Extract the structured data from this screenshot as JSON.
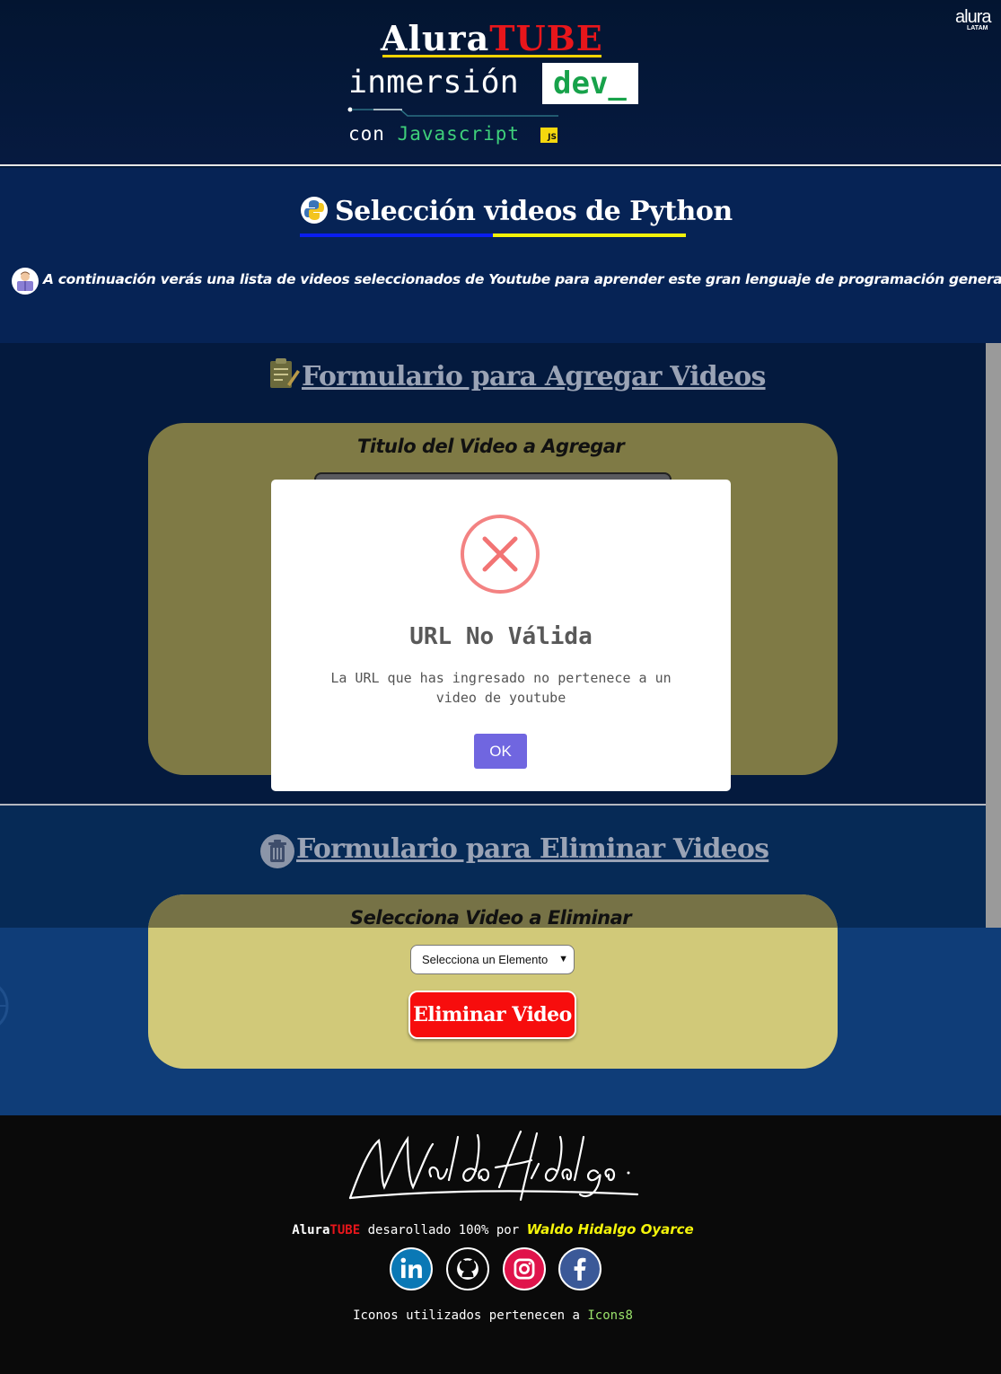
{
  "header": {
    "brand_alura": "Alura",
    "brand_tube": "TUBE",
    "inmersion": "inmersión",
    "dev": "dev_",
    "con": "con",
    "javascript": "Javascript",
    "js_badge": "JS",
    "corner_logo": "alura",
    "corner_logo_sub": "LATAM"
  },
  "intro": {
    "title": "Selección videos de Python",
    "text": "A continuación verás una lista de videos seleccionados de Youtube para aprender este gran lenguaje de programación general"
  },
  "add_form": {
    "title": "Formulario para Agregar Videos",
    "label": "Titulo del Video a Agregar"
  },
  "delete_form": {
    "title": "Formulario para Eliminar Videos",
    "label": "Selecciona Video a Eliminar",
    "select_value": "Selecciona un Elemento",
    "button": "Eliminar Video"
  },
  "footer": {
    "signature": "Waldo Hidalgo",
    "brand_alura": "Alura",
    "brand_tube": "TUBE",
    "developed_text": " desarollado 100% por ",
    "author": "Waldo Hidalgo Oyarce",
    "icons_text": "Iconos utilizados pertenecen a ",
    "icons_link": "Icons8",
    "social": [
      "linkedin-icon",
      "github-icon",
      "instagram-icon",
      "facebook-icon"
    ]
  },
  "modal": {
    "title": "URL No Válida",
    "text": "La URL que has ingresado no pertenece a un video de youtube",
    "ok": "OK"
  },
  "colors": {
    "accent_red": "#e8161b",
    "accent_yellow": "#f2f20a",
    "modal_button": "#7066e0",
    "error_icon": "#f27474"
  }
}
